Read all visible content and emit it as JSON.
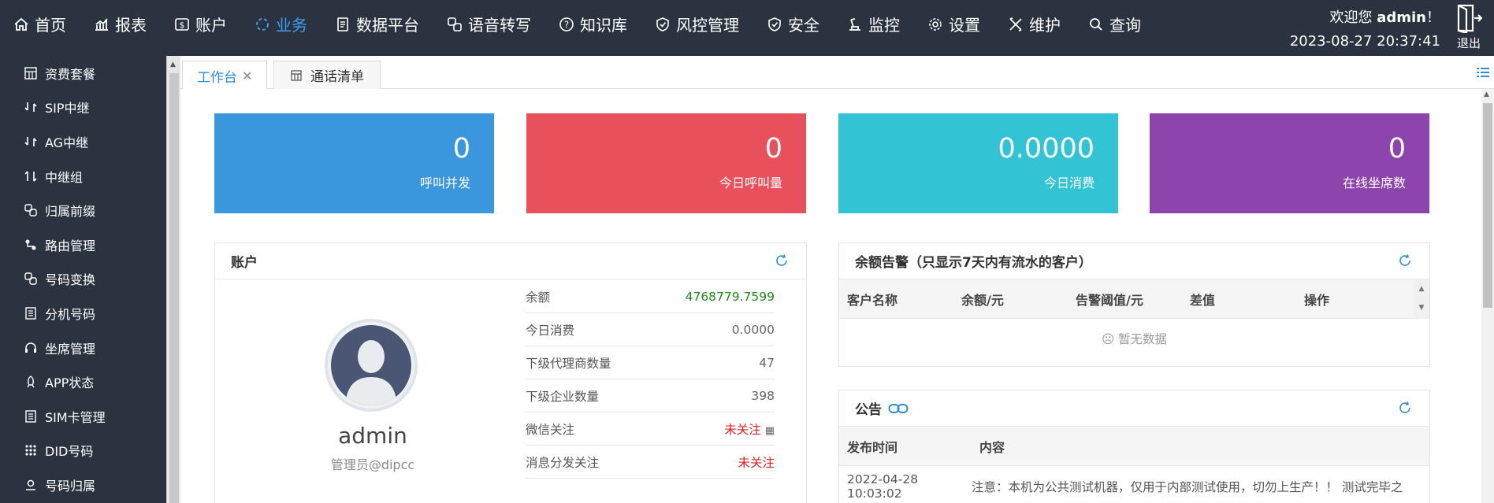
{
  "nav": {
    "items": [
      {
        "label": "首页",
        "icon": "home-icon"
      },
      {
        "label": "报表",
        "icon": "chart-icon"
      },
      {
        "label": "账户",
        "icon": "dollar-icon"
      },
      {
        "label": "业务",
        "icon": "spinner-icon",
        "active": true
      },
      {
        "label": "数据平台",
        "icon": "document-icon"
      },
      {
        "label": "语音转写",
        "icon": "link-icon"
      },
      {
        "label": "知识库",
        "icon": "question-icon"
      },
      {
        "label": "风控管理",
        "icon": "shield-check-icon"
      },
      {
        "label": "安全",
        "icon": "shield-icon"
      },
      {
        "label": "监控",
        "icon": "monitor-icon"
      },
      {
        "label": "设置",
        "icon": "gear-icon"
      },
      {
        "label": "维护",
        "icon": "tools-icon"
      },
      {
        "label": "查询",
        "icon": "search-icon"
      }
    ],
    "active_color": "#3c9ef0"
  },
  "user": {
    "welcome": "欢迎您",
    "name": "admin",
    "suffix": "！",
    "datetime": "2023-08-27 20:37:41",
    "logout_label": "退出"
  },
  "sidebar": {
    "items": [
      {
        "label": "资费套餐",
        "icon": "grid-icon"
      },
      {
        "label": "SIP中继",
        "icon": "relay-icon"
      },
      {
        "label": "AG中继",
        "icon": "relay-icon"
      },
      {
        "label": "中继组",
        "icon": "relay-group-icon"
      },
      {
        "label": "归属前缀",
        "icon": "link-icon"
      },
      {
        "label": "路由管理",
        "icon": "route-icon"
      },
      {
        "label": "号码变换",
        "icon": "link-icon"
      },
      {
        "label": "分机号码",
        "icon": "list-icon"
      },
      {
        "label": "坐席管理",
        "icon": "headset-icon"
      },
      {
        "label": "APP状态",
        "icon": "rocket-icon"
      },
      {
        "label": "SIM卡管理",
        "icon": "list-icon"
      },
      {
        "label": "DID号码",
        "icon": "dots-grid-icon"
      },
      {
        "label": "号码归属",
        "icon": "location-icon"
      }
    ]
  },
  "tabs": [
    {
      "label": "工作台",
      "active": true,
      "closable": true
    },
    {
      "label": "通话清单",
      "active": false
    }
  ],
  "stats": [
    {
      "value": "0",
      "label": "呼叫并发",
      "color": "#3a97dd"
    },
    {
      "value": "0",
      "label": "今日呼叫量",
      "color": "#e8505b"
    },
    {
      "value": "0.0000",
      "label": "今日消费",
      "color": "#32c4d4"
    },
    {
      "value": "0",
      "label": "在线坐席数",
      "color": "#8e44ad"
    }
  ],
  "account": {
    "title": "账户",
    "username": "admin",
    "role": "管理员@dipcc",
    "rows": [
      {
        "label": "余额",
        "value": "4768779.7599",
        "style": "green"
      },
      {
        "label": "今日消费",
        "value": "0.0000",
        "style": "normal"
      },
      {
        "label": "下级代理商数量",
        "value": "47",
        "style": "normal"
      },
      {
        "label": "下级企业数量",
        "value": "398",
        "style": "normal"
      },
      {
        "label": "微信关注",
        "value": "未关注",
        "style": "red",
        "qr": true
      },
      {
        "label": "消息分发关注",
        "value": "未关注",
        "style": "red"
      }
    ]
  },
  "balance_alert": {
    "title": "余额告警（只显示7天内有流水的客户）",
    "columns": [
      "客户名称",
      "余额/元",
      "告警阈值/元",
      "差值",
      "操作"
    ],
    "empty_text": "暂无数据"
  },
  "notice": {
    "title": "公告",
    "columns": [
      "发布时间",
      "内容"
    ],
    "rows": [
      {
        "time": "2022-04-28 10:03:02",
        "content": "注意：本机为公共测试机器，仅用于内部测试使用，切勿上生产！！ 测试完毕之"
      }
    ]
  }
}
